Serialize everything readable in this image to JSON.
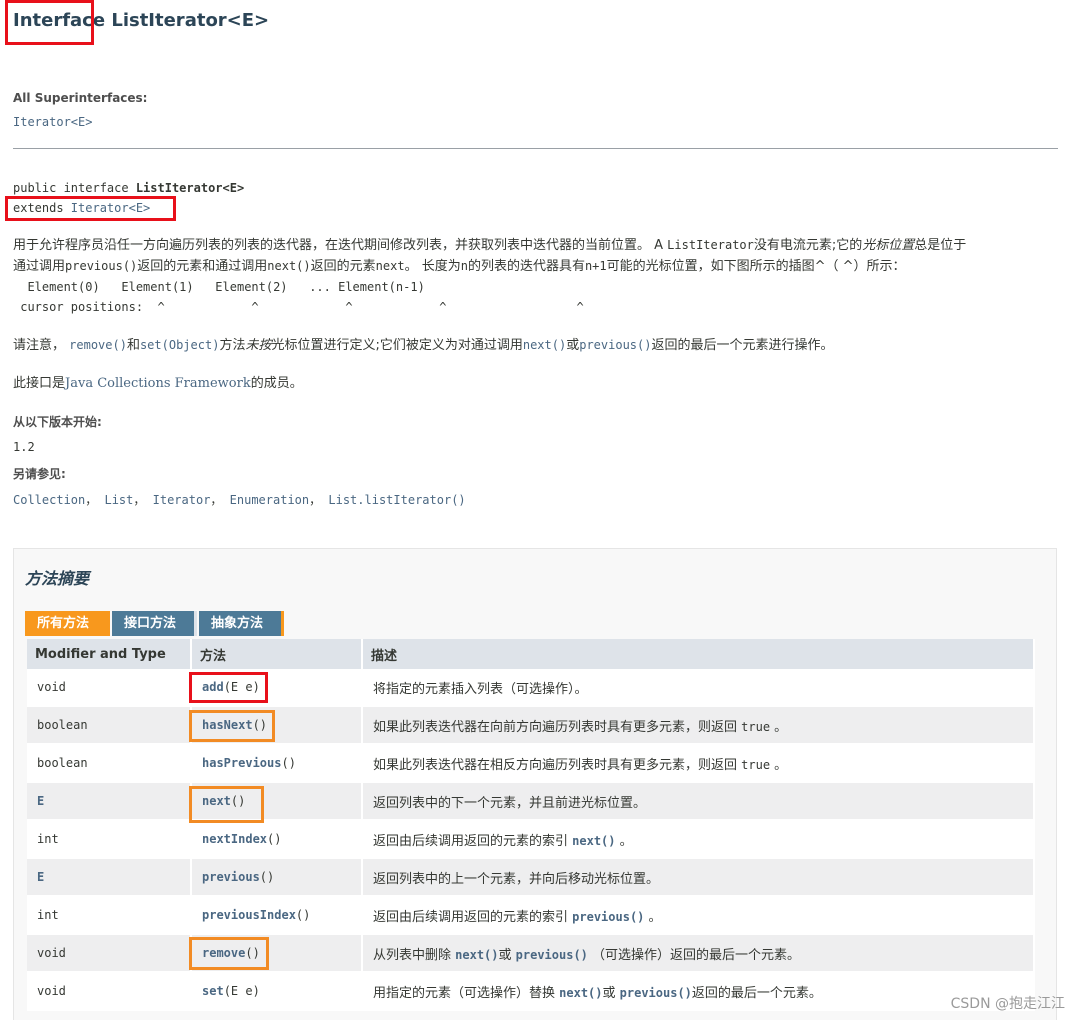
{
  "header": {
    "title_keyword": "Interface",
    "title_name": "ListIterator<E>"
  },
  "superinterfaces": {
    "label": "All Superinterfaces:",
    "link": "Iterator<E>"
  },
  "signature": {
    "line1_prefix": "public interface ",
    "line1_name": "ListIterator<E>",
    "line2_keyword": "extends ",
    "line2_link": "Iterator<E>"
  },
  "description": {
    "p1_a": "用于允许程序员沿任一方向遍历列表的列表的迭代器，在迭代期间修改列表，并获取列表中迭代器的当前位置。 A ",
    "p1_code1": "ListIterator",
    "p1_b": "没有电流元素;它的",
    "p1_ital": "光标位置",
    "p1_c": "总是位于",
    "p1_line2_a": "通过调用",
    "p1_code2": "previous()",
    "p1_line2_b": "返回的元素和通过调用",
    "p1_code3": "next()",
    "p1_line2_c": "返回的元素",
    "p1_code4": "next",
    "p1_line2_d": "。 长度为",
    "p1_code5": "n",
    "p1_line2_e": "的列表的迭代器具有",
    "p1_code6": "n+1",
    "p1_line2_f": "可能的光标位置，如下图所示的插图^（ ^）所示：",
    "diagram_line1": "  Element(0)   Element(1)   Element(2)   ... Element(n-1)",
    "diagram_line2": " cursor positions:  ^            ^            ^            ^                  ^",
    "p2_a": "请注意， ",
    "p2_link1": "remove()",
    "p2_b": "和",
    "p2_link2": "set(Object)",
    "p2_c": "方法",
    "p2_ital": "未按",
    "p2_d": "光标位置进行定义;它们被定义为对通过调用",
    "p2_link3": "next()",
    "p2_e": "或",
    "p2_link4": "previous()",
    "p2_f": "返回的最后一个元素进行操作。",
    "p3_a": "此接口是",
    "p3_link": "Java Collections Framework",
    "p3_b": "的成员。"
  },
  "since": {
    "label": "从以下版本开始:",
    "value": "1.2"
  },
  "see_also": {
    "label": "另请参见:",
    "links": [
      "Collection",
      "List",
      "Iterator",
      "Enumeration",
      "List.listIterator()"
    ]
  },
  "method_summary": {
    "title": "方法摘要",
    "tabs": [
      "所有方法",
      "接口方法",
      "抽象方法"
    ],
    "columns": [
      "Modifier and Type",
      "方法",
      "描述"
    ],
    "rows": [
      {
        "mod": "void",
        "name": "add",
        "args": "(E e)",
        "desc_pre": "将指定的元素插入列表（可选操作）。",
        "code1": "",
        "desc_mid": "",
        "code2": "",
        "desc_post": ""
      },
      {
        "mod": "boolean",
        "name": "hasNext",
        "args": "()",
        "desc_pre": "如果此列表迭代器在向前方向遍历列表时具有更多元素，则返回 ",
        "code1": "true",
        "desc_mid": " 。",
        "code2": "",
        "desc_post": ""
      },
      {
        "mod": "boolean",
        "name": "hasPrevious",
        "args": "()",
        "desc_pre": "如果此列表迭代器在相反方向遍历列表时具有更多元素，则返回 ",
        "code1": "true",
        "desc_mid": " 。",
        "code2": "",
        "desc_post": ""
      },
      {
        "mod": "E",
        "name": "next",
        "args": "()",
        "desc_pre": "返回列表中的下一个元素，并且前进光标位置。",
        "code1": "",
        "desc_mid": "",
        "code2": "",
        "desc_post": ""
      },
      {
        "mod": "int",
        "name": "nextIndex",
        "args": "()",
        "desc_pre": "返回由后续调用返回的元素的索引 ",
        "code1": "next()",
        "desc_mid": " 。",
        "code2": "",
        "desc_post": ""
      },
      {
        "mod": "E",
        "name": "previous",
        "args": "()",
        "desc_pre": "返回列表中的上一个元素，并向后移动光标位置。",
        "code1": "",
        "desc_mid": "",
        "code2": "",
        "desc_post": ""
      },
      {
        "mod": "int",
        "name": "previousIndex",
        "args": "()",
        "desc_pre": "返回由后续调用返回的元素的索引 ",
        "code1": "previous()",
        "desc_mid": " 。",
        "code2": "",
        "desc_post": ""
      },
      {
        "mod": "void",
        "name": "remove",
        "args": "()",
        "desc_pre": "从列表中删除 ",
        "code1": "next()",
        "desc_mid": "或 ",
        "code2": "previous()",
        "desc_post": " （可选操作）返回的最后一个元素。"
      },
      {
        "mod": "void",
        "name": "set",
        "args": "(E e)",
        "desc_pre": "用指定的元素（可选操作）替换 ",
        "code1": "next()",
        "desc_mid": "或 ",
        "code2": "previous()",
        "desc_post": "返回的最后一个元素。"
      }
    ]
  },
  "watermark": "CSDN @抱走江江",
  "colors": {
    "annotation_red": "#e8101a",
    "annotation_orange": "#f28b24",
    "tab_active": "#f8981d",
    "tab_inactive": "#4d7a97",
    "link": "#4a6782"
  }
}
